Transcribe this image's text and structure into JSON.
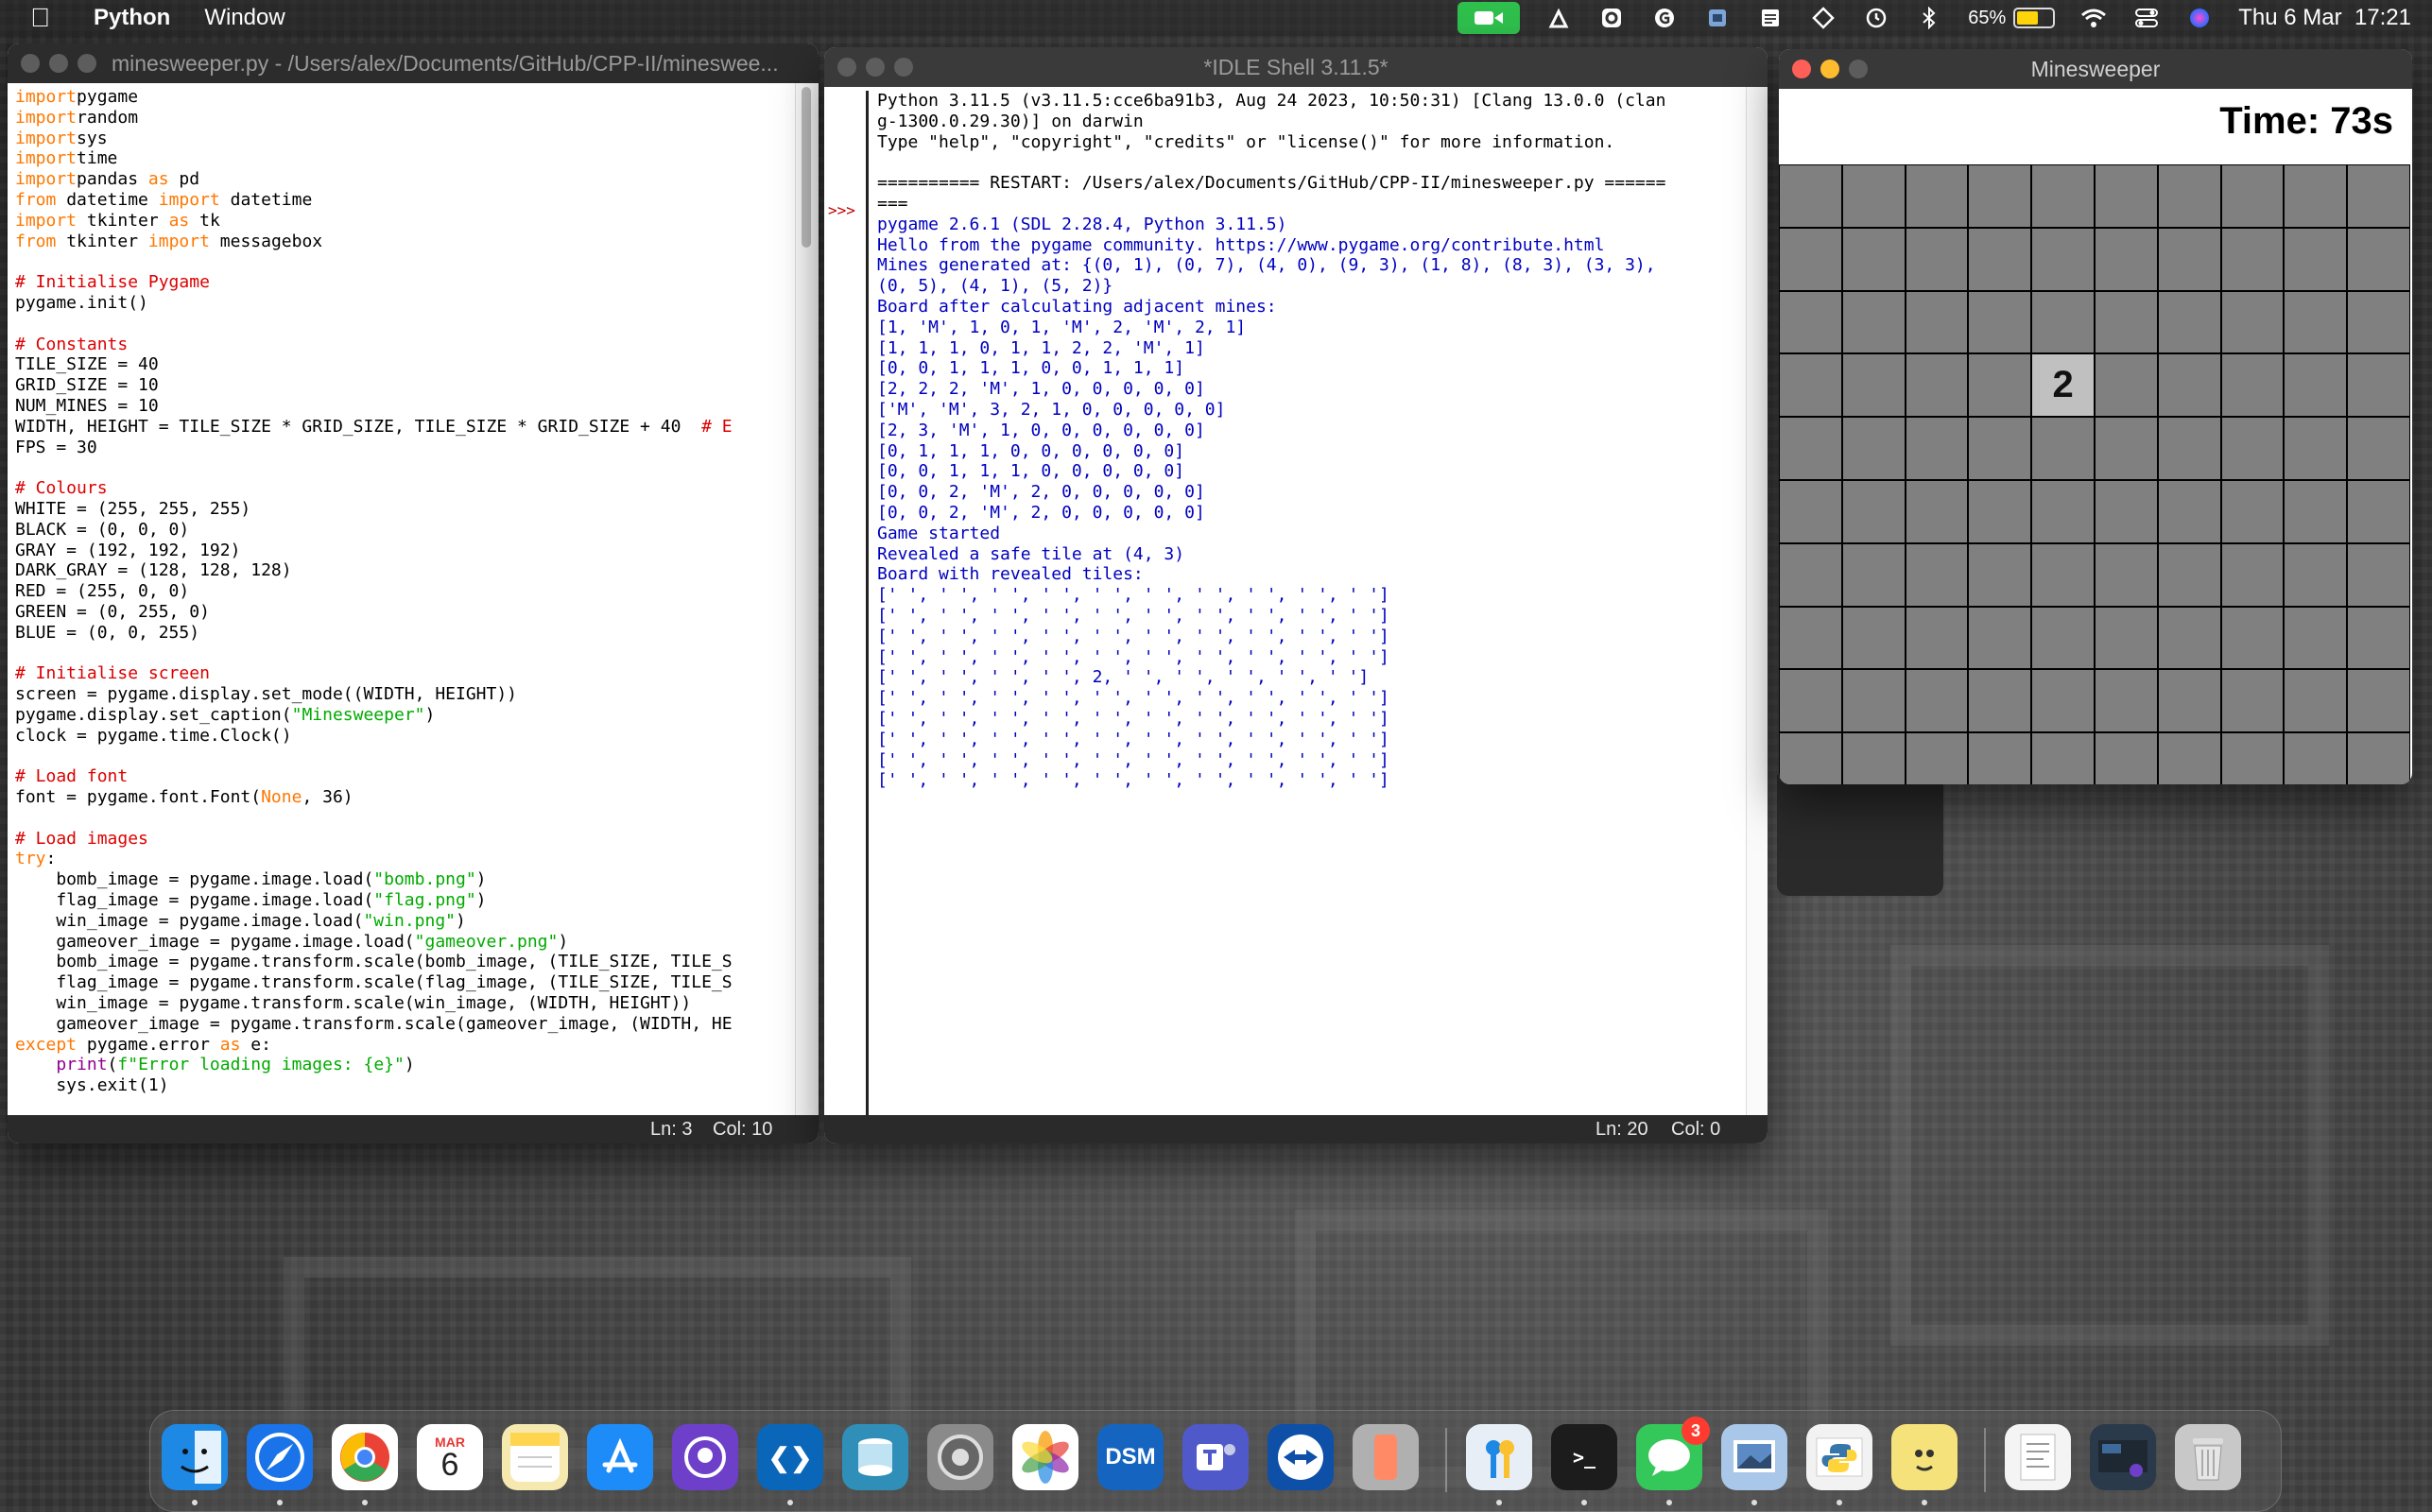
{
  "menubar": {
    "app_name": "Python",
    "menus": [
      "Window"
    ],
    "battery_percent": "65%",
    "battery_level": 0.65,
    "datetime": "Thu 6 Mar  17:21"
  },
  "editor": {
    "title": "minesweeper.py - /Users/alex/Documents/GitHub/CPP-II/mineswee...",
    "status_ln": "Ln: 3",
    "status_col": "Col: 10",
    "lines": [
      [
        [
          "kw",
          "import"
        ],
        [
          "",
          "pygame"
        ]
      ],
      [
        [
          "kw",
          "import"
        ],
        [
          "",
          "random"
        ]
      ],
      [
        [
          "kw",
          "import"
        ],
        [
          "",
          "sys"
        ]
      ],
      [
        [
          "kw",
          "import"
        ],
        [
          "",
          "time"
        ]
      ],
      [
        [
          "kw",
          "import"
        ],
        [
          "",
          "pandas "
        ],
        [
          "kw",
          "as"
        ],
        [
          "",
          " pd"
        ]
      ],
      [
        [
          "kw",
          "from"
        ],
        [
          "",
          " datetime "
        ],
        [
          "kw",
          "import"
        ],
        [
          "",
          " datetime"
        ]
      ],
      [
        [
          "kw",
          "import"
        ],
        [
          "",
          " tkinter "
        ],
        [
          "kw",
          "as"
        ],
        [
          "",
          " tk"
        ]
      ],
      [
        [
          "kw",
          "from"
        ],
        [
          "",
          " tkinter "
        ],
        [
          "kw",
          "import"
        ],
        [
          "",
          " messagebox"
        ]
      ],
      [
        [
          "",
          ""
        ]
      ],
      [
        [
          "cm",
          "# Initialise Pygame"
        ]
      ],
      [
        [
          "",
          "pygame.init()"
        ]
      ],
      [
        [
          "",
          ""
        ]
      ],
      [
        [
          "cm",
          "# Constants"
        ]
      ],
      [
        [
          "",
          "TILE_SIZE = 40"
        ]
      ],
      [
        [
          "",
          "GRID_SIZE = 10"
        ]
      ],
      [
        [
          "",
          "NUM_MINES = 10"
        ]
      ],
      [
        [
          "",
          "WIDTH, HEIGHT = TILE_SIZE * GRID_SIZE, TILE_SIZE * GRID_SIZE + 40  "
        ],
        [
          "cm",
          "# E"
        ]
      ],
      [
        [
          "",
          "FPS = 30"
        ]
      ],
      [
        [
          "",
          ""
        ]
      ],
      [
        [
          "cm",
          "# Colours"
        ]
      ],
      [
        [
          "",
          "WHITE = (255, 255, 255)"
        ]
      ],
      [
        [
          "",
          "BLACK = (0, 0, 0)"
        ]
      ],
      [
        [
          "",
          "GRAY = (192, 192, 192)"
        ]
      ],
      [
        [
          "",
          "DARK_GRAY = (128, 128, 128)"
        ]
      ],
      [
        [
          "",
          "RED = (255, 0, 0)"
        ]
      ],
      [
        [
          "",
          "GREEN = (0, 255, 0)"
        ]
      ],
      [
        [
          "",
          "BLUE = (0, 0, 255)"
        ]
      ],
      [
        [
          "",
          ""
        ]
      ],
      [
        [
          "cm",
          "# Initialise screen"
        ]
      ],
      [
        [
          "",
          "screen = pygame.display.set_mode((WIDTH, HEIGHT))"
        ]
      ],
      [
        [
          "",
          "pygame.display.set_caption("
        ],
        [
          "st",
          "\"Minesweeper\""
        ],
        [
          "",
          ")"
        ]
      ],
      [
        [
          "",
          "clock = pygame.time.Clock()"
        ]
      ],
      [
        [
          "",
          ""
        ]
      ],
      [
        [
          "cm",
          "# Load font"
        ]
      ],
      [
        [
          "",
          "font = pygame.font.Font("
        ],
        [
          "kw",
          "None"
        ],
        [
          "",
          ", 36)"
        ]
      ],
      [
        [
          "",
          ""
        ]
      ],
      [
        [
          "cm",
          "# Load images"
        ]
      ],
      [
        [
          "kw",
          "try"
        ],
        [
          "",
          ":"
        ]
      ],
      [
        [
          "",
          "    bomb_image = pygame.image.load("
        ],
        [
          "st",
          "\"bomb.png\""
        ],
        [
          "",
          ")"
        ]
      ],
      [
        [
          "",
          "    flag_image = pygame.image.load("
        ],
        [
          "st",
          "\"flag.png\""
        ],
        [
          "",
          ")"
        ]
      ],
      [
        [
          "",
          "    win_image = pygame.image.load("
        ],
        [
          "st",
          "\"win.png\""
        ],
        [
          "",
          ")"
        ]
      ],
      [
        [
          "",
          "    gameover_image = pygame.image.load("
        ],
        [
          "st",
          "\"gameover.png\""
        ],
        [
          "",
          ")"
        ]
      ],
      [
        [
          "",
          "    bomb_image = pygame.transform.scale(bomb_image, (TILE_SIZE, TILE_S"
        ]
      ],
      [
        [
          "",
          "    flag_image = pygame.transform.scale(flag_image, (TILE_SIZE, TILE_S"
        ]
      ],
      [
        [
          "",
          "    win_image = pygame.transform.scale(win_image, (WIDTH, HEIGHT))"
        ]
      ],
      [
        [
          "",
          "    gameover_image = pygame.transform.scale(gameover_image, (WIDTH, HE"
        ]
      ],
      [
        [
          "kw",
          "except"
        ],
        [
          "",
          " pygame.error "
        ],
        [
          "kw",
          "as"
        ],
        [
          "",
          " e:"
        ]
      ],
      [
        [
          "",
          "    "
        ],
        [
          "bi",
          "print"
        ],
        [
          "",
          "("
        ],
        [
          "st",
          "f\"Error loading images: {e}\""
        ],
        [
          "",
          ")"
        ]
      ],
      [
        [
          "",
          "    sys.exit(1)"
        ]
      ]
    ]
  },
  "shell": {
    "title": "*IDLE Shell 3.11.5*",
    "prompt": ">>>",
    "status_ln": "Ln: 20",
    "status_col": "Col: 0",
    "header_lines": [
      "Python 3.11.5 (v3.11.5:cce6ba91b3, Aug 24 2023, 10:50:31) [Clang 13.0.0 (clan",
      "g-1300.0.29.30)] on darwin",
      "Type \"help\", \"copyright\", \"credits\" or \"license()\" for more information.",
      "",
      "========== RESTART: /Users/alex/Documents/GitHub/CPP-II/minesweeper.py ======",
      "==="
    ],
    "output_lines": [
      "pygame 2.6.1 (SDL 2.28.4, Python 3.11.5)",
      "Hello from the pygame community. https://www.pygame.org/contribute.html",
      "Mines generated at: {(0, 1), (0, 7), (4, 0), (9, 3), (1, 8), (8, 3), (3, 3),",
      "(0, 5), (4, 1), (5, 2)}",
      "Board after calculating adjacent mines:",
      "[1, 'M', 1, 0, 1, 'M', 2, 'M', 2, 1]",
      "[1, 1, 1, 0, 1, 1, 2, 2, 'M', 1]",
      "[0, 0, 1, 1, 1, 0, 0, 1, 1, 1]",
      "[2, 2, 2, 'M', 1, 0, 0, 0, 0, 0]",
      "['M', 'M', 3, 2, 1, 0, 0, 0, 0, 0]",
      "[2, 3, 'M', 1, 0, 0, 0, 0, 0, 0]",
      "[0, 1, 1, 1, 0, 0, 0, 0, 0, 0]",
      "[0, 0, 1, 1, 1, 0, 0, 0, 0, 0]",
      "[0, 0, 2, 'M', 2, 0, 0, 0, 0, 0]",
      "[0, 0, 2, 'M', 2, 0, 0, 0, 0, 0]",
      "Game started",
      "Revealed a safe tile at (4, 3)",
      "Board with revealed tiles:",
      "[' ', ' ', ' ', ' ', ' ', ' ', ' ', ' ', ' ', ' ']",
      "[' ', ' ', ' ', ' ', ' ', ' ', ' ', ' ', ' ', ' ']",
      "[' ', ' ', ' ', ' ', ' ', ' ', ' ', ' ', ' ', ' ']",
      "[' ', ' ', ' ', ' ', ' ', ' ', ' ', ' ', ' ', ' ']",
      "[' ', ' ', ' ', ' ', 2, ' ', ' ', ' ', ' ', ' ']",
      "[' ', ' ', ' ', ' ', ' ', ' ', ' ', ' ', ' ', ' ']",
      "[' ', ' ', ' ', ' ', ' ', ' ', ' ', ' ', ' ', ' ']",
      "[' ', ' ', ' ', ' ', ' ', ' ', ' ', ' ', ' ', ' ']",
      "[' ', ' ', ' ', ' ', ' ', ' ', ' ', ' ', ' ', ' ']",
      "[' ', ' ', ' ', ' ', ' ', ' ', ' ', ' ', ' ', ' ']"
    ]
  },
  "game": {
    "title": "Minesweeper",
    "timer": "Time: 73s",
    "grid_size": 10,
    "revealed": [
      {
        "row": 3,
        "col": 4,
        "value": "2"
      }
    ]
  },
  "dock": {
    "calendar_month": "MAR",
    "calendar_day": "6",
    "vscode_glyph": "❮❯",
    "dsm_label": "DSM",
    "terminal_glyph": ">_",
    "messages_badge": "3",
    "apps": [
      {
        "name": "finder",
        "color": "#1e88e5",
        "running": true
      },
      {
        "name": "safari",
        "color": "#1a73e8",
        "running": true
      },
      {
        "name": "chrome",
        "color": "#ffffff",
        "running": true
      },
      {
        "name": "calendar",
        "color": "#ffffff",
        "running": false
      },
      {
        "name": "notes",
        "color": "#f5e9b0",
        "running": false
      },
      {
        "name": "app-store",
        "color": "#1d8cf8",
        "running": false
      },
      {
        "name": "github-desktop",
        "color": "#6e40c9",
        "running": false
      },
      {
        "name": "vscode",
        "color": "#0a66b8",
        "running": true
      },
      {
        "name": "database",
        "color": "#2f8fb8",
        "running": false
      },
      {
        "name": "system-settings",
        "color": "#8a8a8a",
        "running": false
      },
      {
        "name": "photos",
        "color": "#ffffff",
        "running": false
      },
      {
        "name": "dsm",
        "color": "#1565c0",
        "running": false
      },
      {
        "name": "teams",
        "color": "#5059c9",
        "running": false
      },
      {
        "name": "teamviewer",
        "color": "#0e4fa8",
        "running": false
      },
      {
        "name": "iphone-mirroring",
        "color": "#b0b0b0",
        "running": false
      },
      {
        "name": "keychain",
        "color": "#e8eef5",
        "running": true
      },
      {
        "name": "terminal",
        "color": "#1c1c1c",
        "running": true
      },
      {
        "name": "messages",
        "color": "#34c759",
        "running": true
      },
      {
        "name": "preview",
        "color": "#a9c7e8",
        "running": true
      },
      {
        "name": "idle-python",
        "color": "#f2f2f2",
        "running": true
      },
      {
        "name": "python-launcher",
        "color": "#f6e27a",
        "running": true
      },
      {
        "name": "document",
        "color": "#f4f4f4",
        "running": false
      },
      {
        "name": "screenshot",
        "color": "#2b3a4a",
        "running": false
      },
      {
        "name": "trash",
        "color": "#c8c8c8",
        "running": false
      }
    ]
  }
}
